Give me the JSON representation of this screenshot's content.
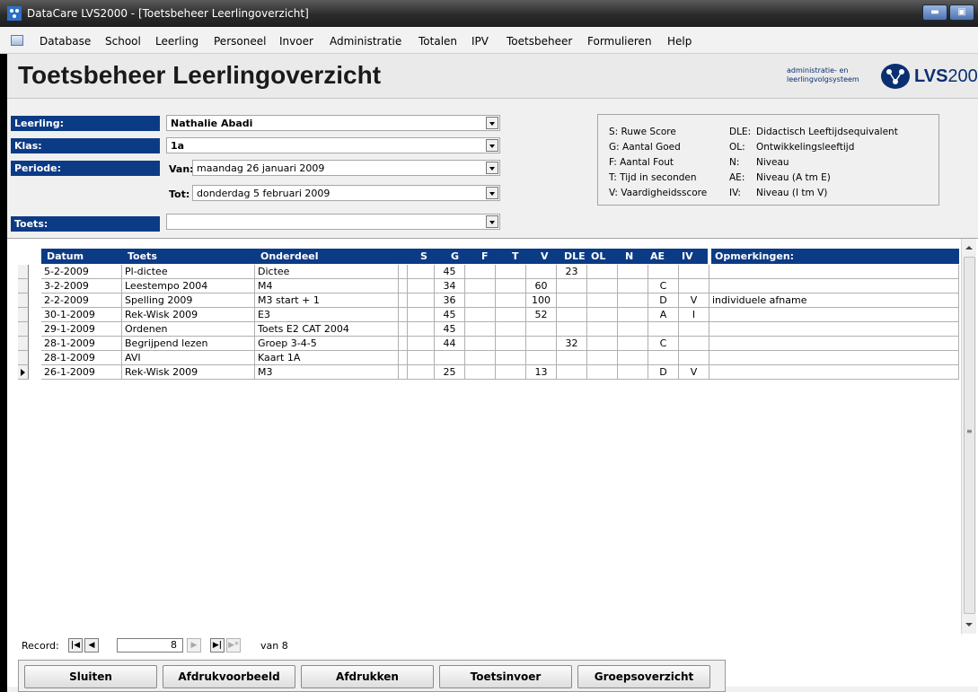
{
  "window": {
    "title": "DataCare LVS2000 - [Toetsbeheer Leerlingoverzicht]",
    "min_glyph": "▬",
    "restore_glyph": "▣"
  },
  "menu": {
    "items": [
      "Database",
      "School",
      "Leerling",
      "Personeel",
      "Invoer",
      "Administratie",
      "Totalen",
      "IPV",
      "Toetsbeheer",
      "Formulieren",
      "Help"
    ]
  },
  "page": {
    "title": "Toetsbeheer Leerlingoverzicht",
    "logo_line1": "administratie- en",
    "logo_line2": "leerlingvolgsysteem",
    "logo_lvs": "LVS",
    "logo_year": "2000"
  },
  "form": {
    "leerling_label": "Leerling:",
    "leerling_value": "Nathalie Abadi",
    "klas_label": "Klas:",
    "klas_value": "1a",
    "periode_label": "Periode:",
    "van_label": "Van:",
    "van_value": "maandag 26 januari 2009",
    "tot_label": "Tot:",
    "tot_value": "donderdag 5 februari 2009",
    "toets_label": "Toets:",
    "toets_value": ""
  },
  "legend": {
    "left": [
      "S: Ruwe Score",
      "G: Aantal Goed",
      "F: Aantal Fout",
      "T: Tijd in seconden",
      "V: Vaardigheidsscore"
    ],
    "right_keys": [
      "DLE:",
      "OL:",
      "N:",
      "AE:",
      "IV:"
    ],
    "right_vals": [
      "Didactisch Leeftijdsequivalent",
      "Ontwikkelingsleeftijd",
      "Niveau",
      "Niveau (A tm E)",
      "Niveau (I tm V)"
    ]
  },
  "grid": {
    "headers": [
      "Datum",
      "Toets",
      "Onderdeel",
      "S",
      "G",
      "F",
      "T",
      "V",
      "DLE",
      "OL",
      "N",
      "AE",
      "IV",
      "Opmerkingen:"
    ],
    "rows": [
      [
        "5-2-2009",
        "Pl-dictee",
        "Dictee",
        "",
        "45",
        "",
        "",
        "",
        "23",
        "",
        "",
        "",
        "",
        ""
      ],
      [
        "3-2-2009",
        "Leestempo 2004",
        "M4",
        "",
        "34",
        "",
        "",
        "60",
        "",
        "",
        "",
        "C",
        "",
        ""
      ],
      [
        "2-2-2009",
        "Spelling 2009",
        "M3 start + 1",
        "",
        "36",
        "",
        "",
        "100",
        "",
        "",
        "",
        "D",
        "V",
        "individuele afname"
      ],
      [
        "30-1-2009",
        "Rek-Wisk 2009",
        "E3",
        "",
        "45",
        "",
        "",
        "52",
        "",
        "",
        "",
        "A",
        "I",
        ""
      ],
      [
        "29-1-2009",
        "Ordenen",
        "Toets E2 CAT 2004",
        "",
        "45",
        "",
        "",
        "",
        "",
        "",
        "",
        "",
        "",
        ""
      ],
      [
        "28-1-2009",
        "Begrijpend lezen",
        "Groep 3-4-5",
        "",
        "44",
        "",
        "",
        "",
        "32",
        "",
        "",
        "C",
        "",
        ""
      ],
      [
        "28-1-2009",
        "AVI",
        "Kaart 1A",
        "",
        "",
        "",
        "",
        "",
        "",
        "",
        "",
        "",
        "",
        ""
      ],
      [
        "26-1-2009",
        "Rek-Wisk 2009",
        "M3",
        "",
        "25",
        "",
        "",
        "13",
        "",
        "",
        "",
        "D",
        "V",
        ""
      ]
    ],
    "current_row": 7
  },
  "navigator": {
    "label": "Record:",
    "current": "8",
    "of_text": "van 8",
    "first": "|◀",
    "prev": "◀",
    "next": "▶",
    "last": "▶|",
    "new": "▶*"
  },
  "buttons": {
    "close": "Sluiten",
    "preview": "Afdrukvoorbeeld",
    "print": "Afdrukken",
    "entry": "Toetsinvoer",
    "group": "Groepsoverzicht"
  },
  "colors": {
    "accent": "#0c3b86",
    "logo": "#0a2f72"
  }
}
